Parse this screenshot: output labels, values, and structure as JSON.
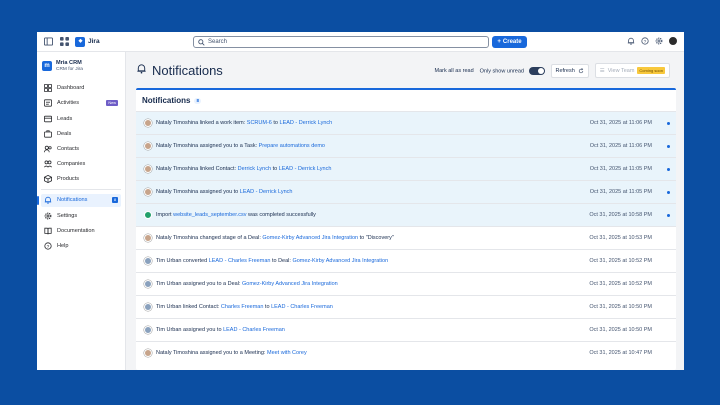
{
  "app": {
    "name": "Jira"
  },
  "search": {
    "placeholder": "Search"
  },
  "create": {
    "label": "Create"
  },
  "project": {
    "name": "Mria CRM",
    "subtitle": "CRM for Jira"
  },
  "sidebar": {
    "items": [
      {
        "label": "Dashboard",
        "icon": "dashboard-icon"
      },
      {
        "label": "Activities",
        "icon": "activities-icon",
        "badge": "New"
      },
      {
        "label": "Leads",
        "icon": "leads-icon"
      },
      {
        "label": "Deals",
        "icon": "deals-icon"
      },
      {
        "label": "Contacts",
        "icon": "contacts-icon"
      },
      {
        "label": "Companies",
        "icon": "companies-icon"
      },
      {
        "label": "Products",
        "icon": "products-icon"
      }
    ],
    "bottom_items": [
      {
        "label": "Notifications",
        "icon": "bell-icon",
        "badge": "8"
      },
      {
        "label": "Settings",
        "icon": "gear-icon"
      },
      {
        "label": "Documentation",
        "icon": "book-icon"
      },
      {
        "label": "Help",
        "icon": "help-icon"
      }
    ]
  },
  "page": {
    "title": "Notifications",
    "mark_all": "Mark all as read",
    "only_unread": "Only show unread",
    "refresh": "Refresh",
    "view_team": "View Team",
    "coming_soon": "Coming soon"
  },
  "card": {
    "title": "Notifications",
    "count": "8"
  },
  "notifications": [
    {
      "actor": "Nataly Timoshina",
      "pre": " linked a work item: ",
      "link1": "SCRUM-6",
      "mid": " to ",
      "link2": "LEAD - Derrick Lynch",
      "post": "",
      "time": "Oct 31, 2025 at 11:06 PM",
      "unread": true,
      "avatar": "nataly"
    },
    {
      "actor": "Nataly Timoshina",
      "pre": " assigned you to a Task: ",
      "link1": "Prepare automations demo",
      "mid": "",
      "link2": "",
      "post": "",
      "time": "Oct 31, 2025 at 11:06 PM",
      "unread": true,
      "avatar": "nataly"
    },
    {
      "actor": "Nataly Timoshina",
      "pre": " linked Contact: ",
      "link1": "Derrick Lynch",
      "mid": " to ",
      "link2": "LEAD - Derrick Lynch",
      "post": "",
      "time": "Oct 31, 2025 at 11:05 PM",
      "unread": true,
      "avatar": "nataly"
    },
    {
      "actor": "Nataly Timoshina",
      "pre": " assigned you to ",
      "link1": "LEAD - Derrick Lynch",
      "mid": "",
      "link2": "",
      "post": "",
      "time": "Oct 31, 2025 at 11:05 PM",
      "unread": true,
      "avatar": "nataly"
    },
    {
      "actor": "",
      "pre": "Import ",
      "link1": "website_leads_september.csv",
      "mid": "",
      "link2": "",
      "post": " was completed successfully",
      "time": "Oct 31, 2025 at 10:58 PM",
      "unread": true,
      "avatar": "ok"
    },
    {
      "actor": "Nataly Timoshina",
      "pre": " changed stage of a Deal: ",
      "link1": "Gomez-Kirby Advanced Jira Integration",
      "mid": "",
      "link2": "",
      "post": " to \"Discovery\"",
      "time": "Oct 31, 2025 at 10:53 PM",
      "unread": false,
      "avatar": "nataly"
    },
    {
      "actor": "Tim Urban",
      "pre": " converted ",
      "link1": "LEAD - Charles Freeman",
      "mid": " to Deal: ",
      "link2": "Gomez-Kirby Advanced Jira Integration",
      "post": "",
      "time": "Oct 31, 2025 at 10:52 PM",
      "unread": false,
      "avatar": "tim"
    },
    {
      "actor": "Tim Urban",
      "pre": " assigned you to a Deal: ",
      "link1": "Gomez-Kirby Advanced Jira Integration",
      "mid": "",
      "link2": "",
      "post": "",
      "time": "Oct 31, 2025 at 10:52 PM",
      "unread": false,
      "avatar": "tim"
    },
    {
      "actor": "Tim Urban",
      "pre": " linked Contact: ",
      "link1": "Charles Freeman",
      "mid": " to ",
      "link2": "LEAD - Charles Freeman",
      "post": "",
      "time": "Oct 31, 2025 at 10:50 PM",
      "unread": false,
      "avatar": "tim"
    },
    {
      "actor": "Tim Urban",
      "pre": " assigned you to ",
      "link1": "LEAD - Charles Freeman",
      "mid": "",
      "link2": "",
      "post": "",
      "time": "Oct 31, 2025 at 10:50 PM",
      "unread": false,
      "avatar": "tim"
    },
    {
      "actor": "Nataly Timoshina",
      "pre": " assigned you to a Meeting: ",
      "link1": "Meet with Corey",
      "mid": "",
      "link2": "",
      "post": "",
      "time": "Oct 31, 2025 at 10:47 PM",
      "unread": false,
      "avatar": "nataly"
    }
  ],
  "colors": {
    "brand": "#1868db",
    "background": "#0b4ea2",
    "unread_row": "#e9f4fb",
    "new_badge": "#6e5dc6",
    "coming_soon": "#f8c83c"
  }
}
